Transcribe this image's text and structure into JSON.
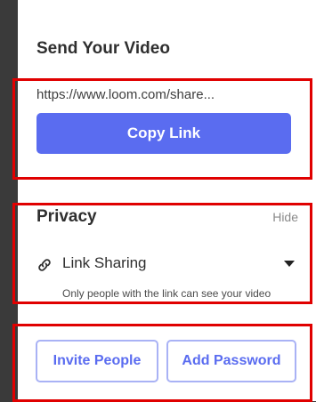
{
  "panel": {
    "title": "Send Your Video"
  },
  "share": {
    "url": "https://www.loom.com/share...",
    "copy_label": "Copy Link"
  },
  "privacy": {
    "title": "Privacy",
    "hide_label": "Hide",
    "sharing_icon": "link-icon",
    "sharing_mode": "Link Sharing",
    "sharing_description": "Only people with the link can see your video"
  },
  "actions": {
    "invite_label": "Invite People",
    "password_label": "Add Password"
  },
  "colors": {
    "accent": "#5a6cf0",
    "highlight": "#e00000"
  }
}
